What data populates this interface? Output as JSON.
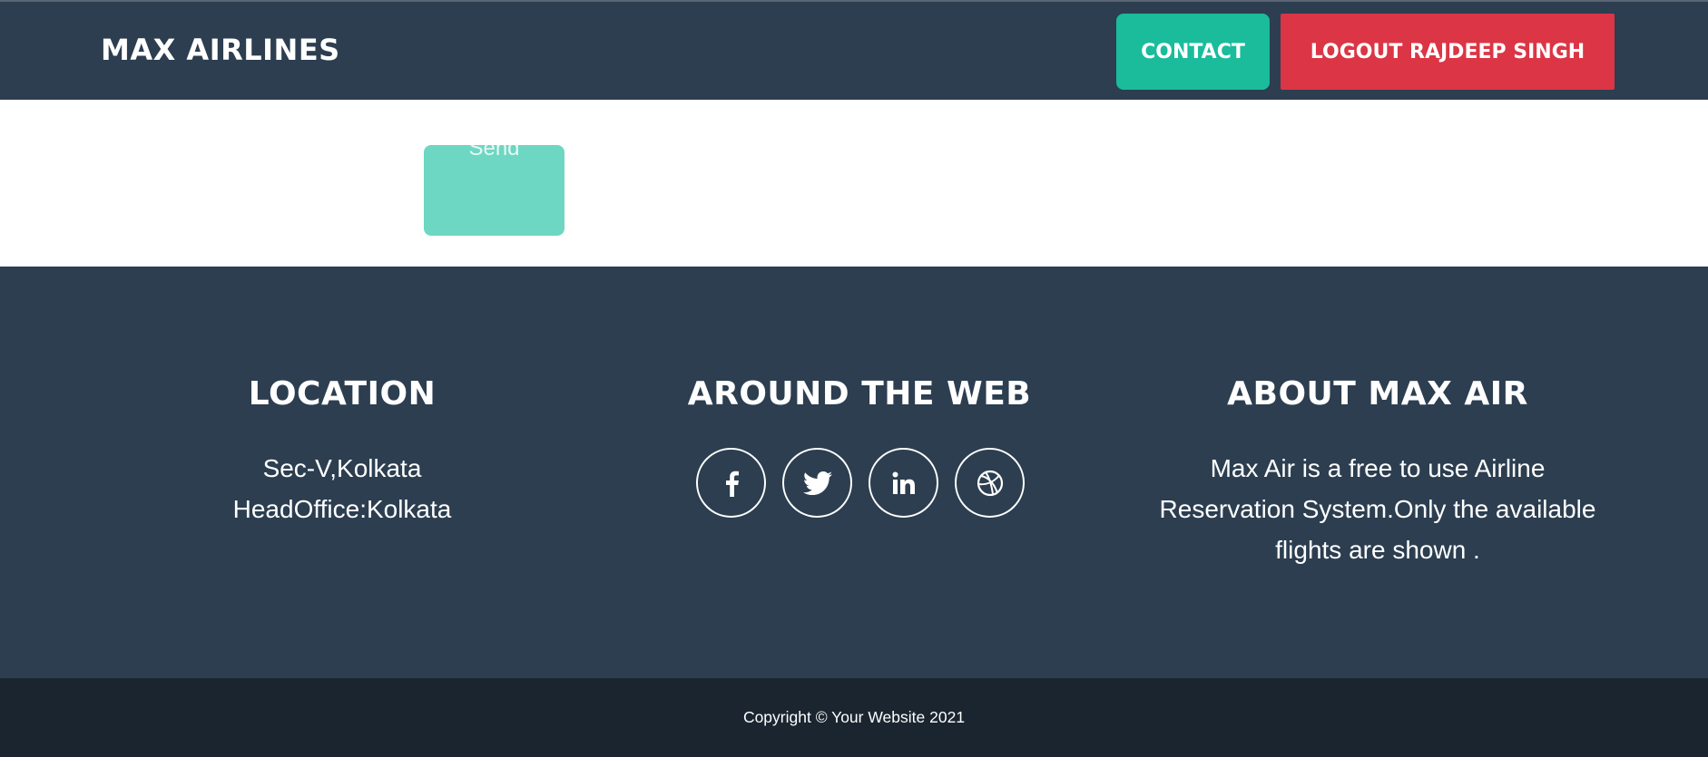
{
  "navbar": {
    "brand": "MAX AIRLINES",
    "contact_label": "CONTACT",
    "logout_label": "LOGOUT RAJDEEP SINGH",
    "colors": {
      "background": "#2c3e50",
      "contact": "#1abc9c",
      "logout": "#dc3545"
    }
  },
  "content": {
    "send_label": "Send"
  },
  "footer": {
    "location": {
      "heading": "LOCATION",
      "line1": "Sec-V,Kolkata",
      "line2": "HeadOffice:Kolkata"
    },
    "web": {
      "heading": "AROUND THE WEB",
      "icons": [
        "facebook-icon",
        "twitter-icon",
        "linkedin-icon",
        "dribbble-icon"
      ]
    },
    "about": {
      "heading": "ABOUT MAX AIR",
      "text": "Max Air is a free to use Airline Reservation System.Only the available flights are shown ."
    }
  },
  "copyright": {
    "text": "Copyright © Your Website 2021"
  }
}
